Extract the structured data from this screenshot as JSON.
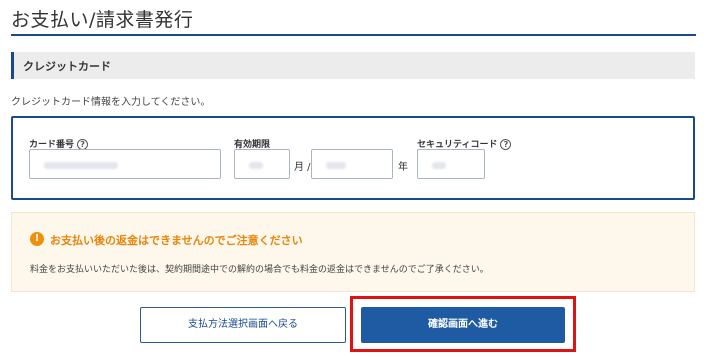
{
  "page": {
    "title": "お支払い/請求書発行"
  },
  "section": {
    "title": "クレジットカード"
  },
  "intro": "クレジットカード情報を入力してください。",
  "card_form": {
    "card_number_label": "カード番号",
    "expiry_label": "有効期限",
    "month_unit": "月 /",
    "year_unit": "年",
    "security_code_label": "セキュリティコード",
    "help_icon": "?"
  },
  "notice": {
    "icon": "!",
    "title": "お支払い後の返金はできませんのでご注意ください",
    "body": "料金をお支払いいただいた後は、契約期間途中での解約の場合でも料金の返金はできませんのでご了承ください。"
  },
  "buttons": {
    "back_label": "支払方法選択画面へ戻る",
    "confirm_label": "確認画面へ進む"
  },
  "colors": {
    "primary": "#1f5ba2",
    "warning": "#e8850a",
    "highlight": "#e01313"
  }
}
